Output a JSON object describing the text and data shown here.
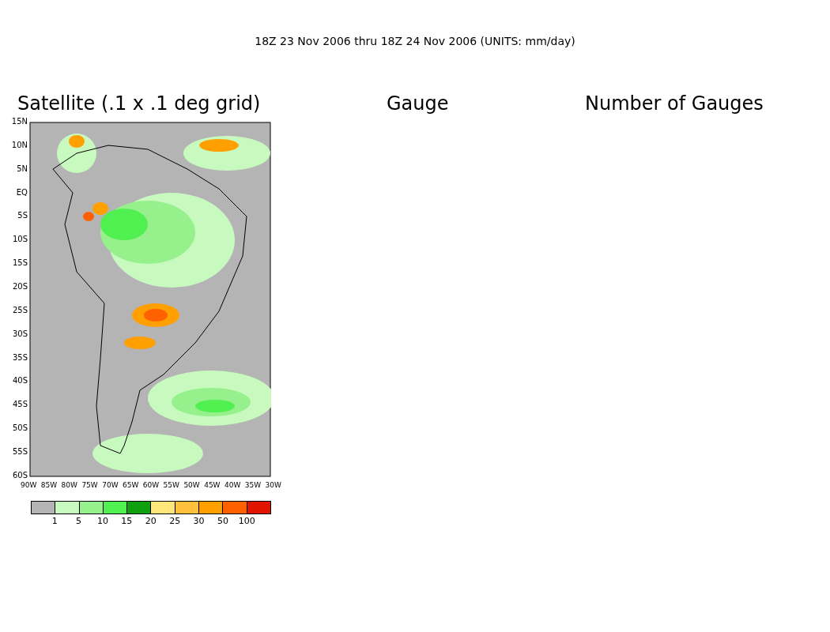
{
  "title": "18Z 23 Nov 2006 thru 18Z 24 Nov 2006 (UNITS: mm/day)",
  "panels": [
    {
      "title": "Satellite (.1 x .1 deg grid)"
    },
    {
      "title": "Gauge"
    },
    {
      "title": "Number of Gauges"
    }
  ],
  "map": {
    "y_axis_labels": [
      "15N",
      "10N",
      "5N",
      "EQ",
      "5S",
      "10S",
      "15S",
      "20S",
      "25S",
      "30S",
      "35S",
      "40S",
      "45S",
      "50S",
      "55S",
      "60S"
    ],
    "x_axis_labels": [
      "90W",
      "85W",
      "80W",
      "75W",
      "70W",
      "65W",
      "60W",
      "55W",
      "50W",
      "45W",
      "40W",
      "35W",
      "30W"
    ]
  },
  "color_bar": {
    "bins": [
      {
        "color": "#b4b4b4"
      },
      {
        "color": "#c8fac0"
      },
      {
        "color": "#96f08c"
      },
      {
        "color": "#50f050"
      },
      {
        "color": "#0fa00f"
      },
      {
        "color": "#ffe67a"
      },
      {
        "color": "#ffc03c"
      },
      {
        "color": "#ffa000"
      },
      {
        "color": "#ff6000"
      },
      {
        "color": "#e11400"
      }
    ],
    "labels": [
      "1",
      "5",
      "10",
      "15",
      "20",
      "25",
      "30",
      "50",
      "100"
    ]
  }
}
